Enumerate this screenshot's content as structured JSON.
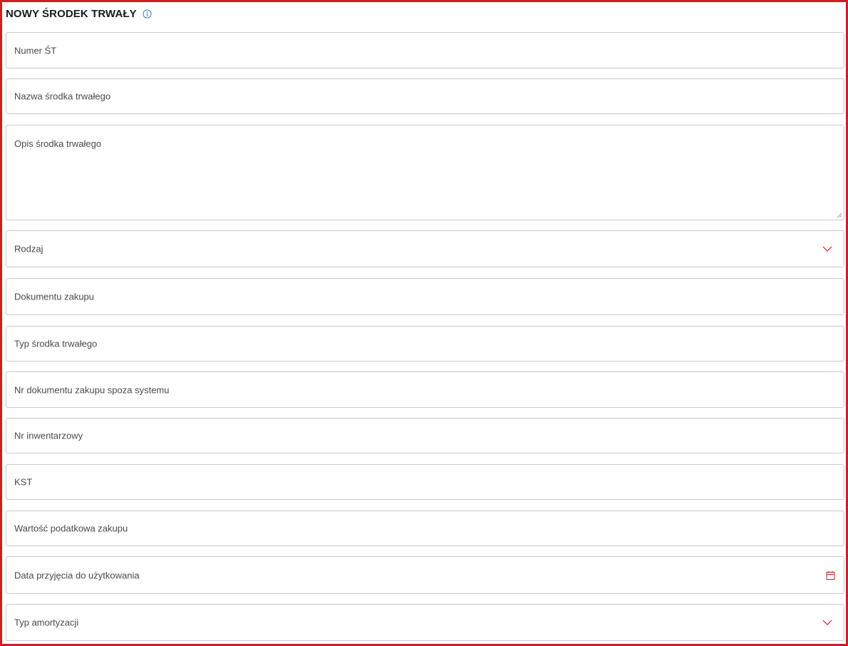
{
  "form": {
    "title": "NOWY ŚRODEK TRWAŁY",
    "fields": {
      "numer": {
        "placeholder": "Numer ŚT"
      },
      "nazwa": {
        "placeholder": "Nazwa środka trwałego"
      },
      "opis": {
        "placeholder": "Opis środka trwałego"
      },
      "rodzaj": {
        "placeholder": "Rodzaj"
      },
      "dokument": {
        "placeholder": "Dokumentu zakupu"
      },
      "typ": {
        "placeholder": "Typ środka trwałego"
      },
      "nr_dokumentu": {
        "placeholder": "Nr dokumentu zakupu spoza systemu"
      },
      "nr_inwentarzowy": {
        "placeholder": "Nr inwentarzowy"
      },
      "kst": {
        "placeholder": "KST"
      },
      "wartosc": {
        "placeholder": "Wartość podatkowa zakupu"
      },
      "data": {
        "placeholder": "Data przyjęcia do użytkowania"
      },
      "amortyzacja": {
        "placeholder": "Typ amortyzacji"
      }
    }
  },
  "icons": {
    "info": "info-circle-icon",
    "dropdown": "chevron-down-icon",
    "date": "calendar-icon"
  },
  "colors": {
    "accent": "#cc1f24",
    "info": "#3b7fc4",
    "border": "#c9c9c9"
  }
}
